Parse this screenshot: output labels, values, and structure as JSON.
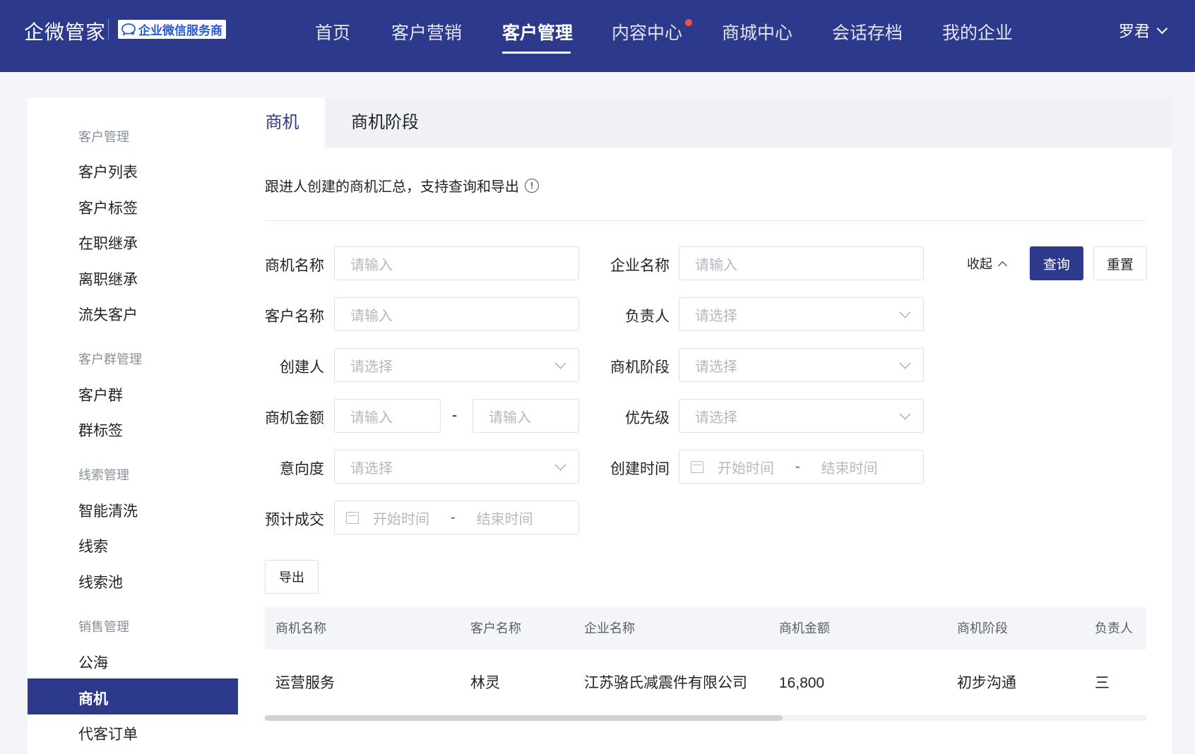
{
  "brand": {
    "name": "企微管家",
    "badge": "企业微信服务商"
  },
  "nav": {
    "items": [
      "首页",
      "客户营销",
      "客户管理",
      "内容中心",
      "商城中心",
      "会话存档",
      "我的企业"
    ],
    "active": "客户管理",
    "user": "罗君"
  },
  "sidebar": {
    "groups": [
      {
        "title": "客户管理",
        "items": [
          "客户列表",
          "客户标签",
          "在职继承",
          "离职继承",
          "流失客户"
        ]
      },
      {
        "title": "客户群管理",
        "items": [
          "客户群",
          "群标签"
        ]
      },
      {
        "title": "线索管理",
        "items": [
          "智能清洗",
          "线索",
          "线索池"
        ]
      },
      {
        "title": "销售管理",
        "items": [
          "公海",
          "商机",
          "代客订单"
        ]
      }
    ],
    "active": "商机"
  },
  "tabs": [
    "商机",
    "商机阶段"
  ],
  "description": "跟进人创建的商机汇总，支持查询和导出",
  "filters": {
    "opportunity_name": {
      "label": "商机名称",
      "placeholder": "请输入"
    },
    "company_name": {
      "label": "企业名称",
      "placeholder": "请输入"
    },
    "customer_name": {
      "label": "客户名称",
      "placeholder": "请输入"
    },
    "owner": {
      "label": "负责人",
      "placeholder": "请选择"
    },
    "creator": {
      "label": "创建人",
      "placeholder": "请选择"
    },
    "stage": {
      "label": "商机阶段",
      "placeholder": "请选择"
    },
    "amount": {
      "label": "商机金额",
      "min_placeholder": "请输入",
      "max_placeholder": "请输入",
      "separator": "-"
    },
    "priority": {
      "label": "优先级",
      "placeholder": "请选择"
    },
    "intent": {
      "label": "意向度",
      "placeholder": "请选择"
    },
    "created_time": {
      "label": "创建时间",
      "start": "开始时间",
      "end": "结束时间",
      "separator": "-"
    },
    "expected_close": {
      "label": "预计成交",
      "start": "开始时间",
      "end": "结束时间",
      "separator": "-"
    }
  },
  "actions": {
    "collapse": "收起",
    "query": "查询",
    "reset": "重置",
    "export": "导出"
  },
  "table": {
    "columns": [
      "商机名称",
      "客户名称",
      "企业名称",
      "商机金额",
      "商机阶段",
      "负责人"
    ],
    "rows": [
      [
        "运营服务",
        "林灵",
        "江苏骆氏减震件有限公司",
        "16,800",
        "初步沟通",
        "三"
      ]
    ]
  }
}
